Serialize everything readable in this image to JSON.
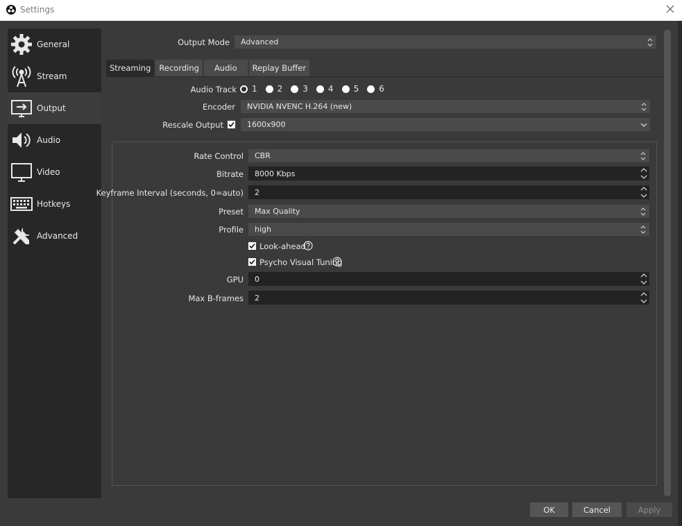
{
  "window": {
    "title": "Settings"
  },
  "sidebar": {
    "items": [
      {
        "label": "General",
        "icon": "gear-icon"
      },
      {
        "label": "Stream",
        "icon": "broadcast-tower-icon"
      },
      {
        "label": "Output",
        "icon": "monitor-output-icon",
        "active": true
      },
      {
        "label": "Audio",
        "icon": "speaker-icon"
      },
      {
        "label": "Video",
        "icon": "monitor-icon"
      },
      {
        "label": "Hotkeys",
        "icon": "keyboard-icon"
      },
      {
        "label": "Advanced",
        "icon": "tools-icon"
      }
    ]
  },
  "output_mode": {
    "label": "Output Mode",
    "value": "Advanced"
  },
  "tabs": [
    {
      "label": "Streaming",
      "active": true
    },
    {
      "label": "Recording"
    },
    {
      "label": "Audio"
    },
    {
      "label": "Replay Buffer"
    }
  ],
  "streaming": {
    "audio_track_label": "Audio Track",
    "audio_tracks": [
      "1",
      "2",
      "3",
      "4",
      "5",
      "6"
    ],
    "audio_track_selected": "1",
    "encoder_label": "Encoder",
    "encoder_value": "NVIDIA NVENC H.264 (new)",
    "rescale_label": "Rescale Output",
    "rescale_checked": true,
    "rescale_value": "1600x900"
  },
  "encoder_settings": {
    "rate_control_label": "Rate Control",
    "rate_control_value": "CBR",
    "bitrate_label": "Bitrate",
    "bitrate_value": "8000 Kbps",
    "keyframe_label": "Keyframe Interval (seconds, 0=auto)",
    "keyframe_value": "2",
    "preset_label": "Preset",
    "preset_value": "Max Quality",
    "profile_label": "Profile",
    "profile_value": "high",
    "lookahead_label": "Look-ahead",
    "lookahead_checked": true,
    "psycho_label": "Psycho Visual Tuning",
    "psycho_checked": true,
    "gpu_label": "GPU",
    "gpu_value": "0",
    "bframes_label": "Max B-frames",
    "bframes_value": "2"
  },
  "buttons": {
    "ok": "OK",
    "cancel": "Cancel",
    "apply": "Apply"
  }
}
